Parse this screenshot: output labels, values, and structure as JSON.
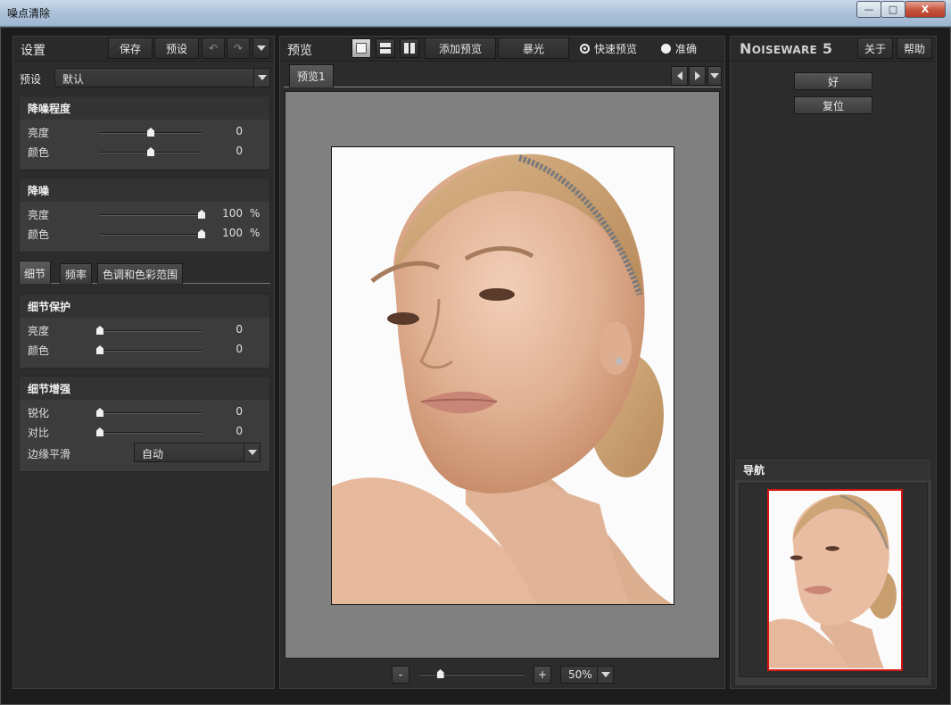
{
  "window": {
    "title": "噪点清除",
    "controls": {
      "minimize": "—",
      "maximize": "□",
      "close": "X"
    }
  },
  "left": {
    "title": "设置",
    "save_label": "保存",
    "presets_label": "预设",
    "preset_label": "预设",
    "preset_value": "默认",
    "noise_level": {
      "title": "降噪程度",
      "rows": [
        {
          "label": "亮度",
          "value": "0",
          "position": 0.5
        },
        {
          "label": "颜色",
          "value": "0",
          "position": 0.5
        }
      ]
    },
    "noise_reduction": {
      "title": "降噪",
      "rows": [
        {
          "label": "亮度",
          "value": "100",
          "unit": "%",
          "position": 1.0
        },
        {
          "label": "颜色",
          "value": "100",
          "unit": "%",
          "position": 1.0
        }
      ]
    },
    "tabs": [
      "细节",
      "频率",
      "色调和色彩范围"
    ],
    "detail_protection": {
      "title": "细节保护",
      "rows": [
        {
          "label": "亮度",
          "value": "0",
          "position": 0.0
        },
        {
          "label": "颜色",
          "value": "0",
          "position": 0.0
        }
      ]
    },
    "detail_enhance": {
      "title": "细节增强",
      "rows": [
        {
          "label": "锐化",
          "value": "0",
          "position": 0.0
        },
        {
          "label": "对比",
          "value": "0",
          "position": 0.0
        }
      ],
      "edge_label": "边缘平滑",
      "edge_value": "自动"
    }
  },
  "center": {
    "title": "预览",
    "add_preview": "添加预览",
    "exposure": "暴光",
    "fast_preview": "快速预览",
    "accurate": "准确",
    "preview_tab": "预览1",
    "zoom_minus": "-",
    "zoom_plus": "+",
    "zoom_value": "50%",
    "zoom_position": 0.2
  },
  "right": {
    "brand_big_n": "N",
    "brand_rest": "OISEWARE",
    "brand_version": " 5",
    "about": "关于",
    "help": "帮助",
    "ok": "好",
    "reset": "复位",
    "navigator": "导航"
  },
  "colors": {
    "accent_red": "#d21414",
    "panel_bg": "#2c2c2c",
    "preview_bg": "#808080"
  }
}
